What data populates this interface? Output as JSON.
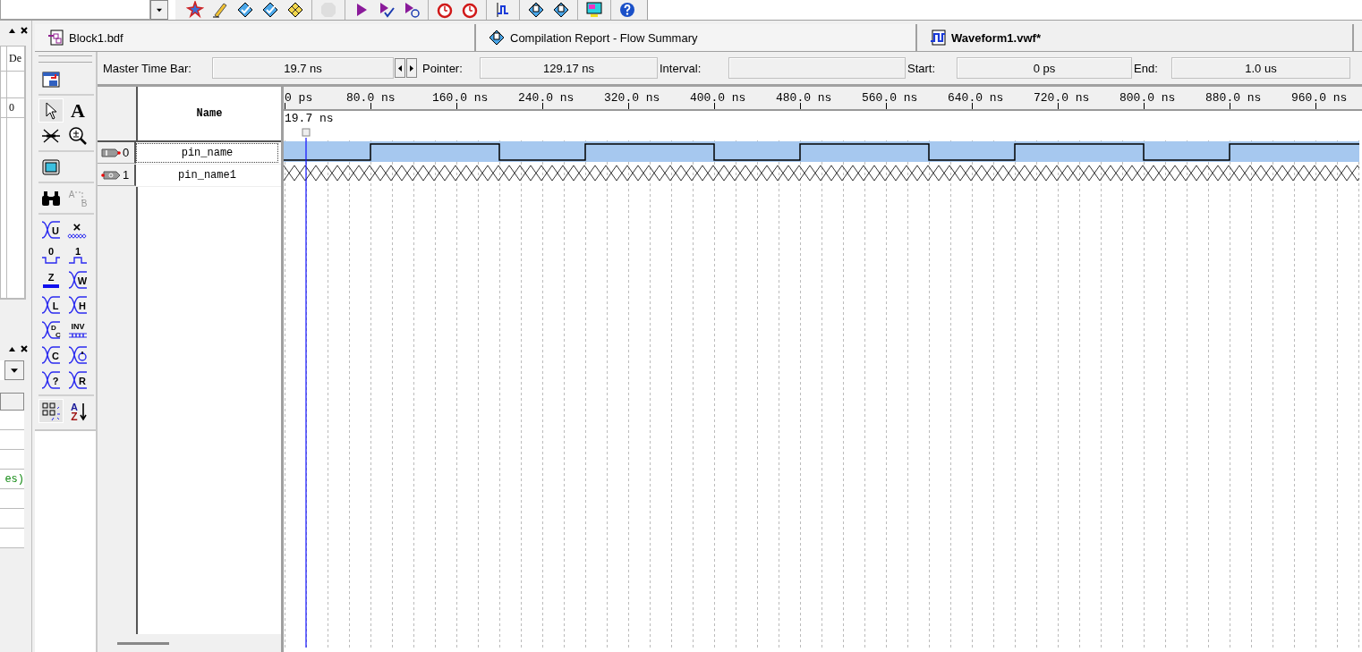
{
  "toolbar_groups": [
    [
      {
        "kind": "compile",
        "disabled": false
      },
      {
        "kind": "pencil",
        "disabled": false
      },
      {
        "kind": "check-diamond",
        "disabled": false
      },
      {
        "kind": "check-diamond",
        "disabled": false
      },
      {
        "kind": "hatch-diamond",
        "disabled": false
      }
    ],
    [
      {
        "kind": "stop",
        "disabled": true
      }
    ],
    [
      {
        "kind": "play",
        "disabled": false
      },
      {
        "kind": "play-check",
        "disabled": false
      },
      {
        "kind": "play-clock",
        "disabled": false
      }
    ],
    [
      {
        "kind": "stopwatch",
        "disabled": false
      },
      {
        "kind": "stopwatch",
        "disabled": false
      }
    ],
    [
      {
        "kind": "wave-flag",
        "disabled": false
      }
    ],
    [
      {
        "kind": "report-diamond",
        "disabled": false
      },
      {
        "kind": "report-diamond",
        "disabled": false
      }
    ],
    [
      {
        "kind": "monitor",
        "disabled": false
      }
    ],
    [
      {
        "kind": "help",
        "disabled": false
      }
    ]
  ],
  "left_panel": {
    "header": "De",
    "value": "0",
    "lower_text": "es)"
  },
  "tabs": [
    {
      "label": "Block1.bdf",
      "kind": "schematic",
      "selected": false
    },
    {
      "label": "Compilation Report - Flow Summary",
      "kind": "report",
      "selected": false
    },
    {
      "label": "Waveform1.vwf*",
      "kind": "waveform",
      "selected": true
    }
  ],
  "tool_groups": [
    [
      {
        "kind": "insert",
        "pressed": false
      }
    ],
    [
      {
        "kind": "select",
        "pressed": true
      },
      {
        "kind": "text",
        "label": "A",
        "pressed": false
      },
      {
        "kind": "fit",
        "pressed": false
      },
      {
        "kind": "zoom",
        "pressed": false
      }
    ],
    [
      {
        "kind": "full-screen",
        "pressed": false
      }
    ],
    [
      {
        "kind": "find",
        "pressed": false
      },
      {
        "kind": "replace",
        "letters": [
          "A",
          "B"
        ],
        "pressed": false
      }
    ],
    [
      {
        "kind": "value",
        "label": "U",
        "pressed": false
      },
      {
        "kind": "unknown",
        "label": "×",
        "pressed": false
      },
      {
        "kind": "low",
        "label": "0",
        "pressed": false
      },
      {
        "kind": "high",
        "label": "1",
        "pressed": false
      },
      {
        "kind": "high-z",
        "label": "Z",
        "pressed": false
      },
      {
        "kind": "value",
        "label": "W",
        "pressed": false
      },
      {
        "kind": "value",
        "label": "L",
        "pressed": false
      },
      {
        "kind": "value",
        "label": "H",
        "pressed": false
      },
      {
        "kind": "dont-care",
        "letters": [
          "D",
          "C"
        ],
        "pressed": false
      },
      {
        "kind": "invert",
        "label": "INV",
        "pressed": false
      },
      {
        "kind": "value",
        "label": "C",
        "pressed": false
      },
      {
        "kind": "clock",
        "pressed": false
      },
      {
        "kind": "value",
        "label": "?",
        "pressed": false
      },
      {
        "kind": "value",
        "label": "R",
        "pressed": false
      }
    ],
    [
      {
        "kind": "snap",
        "pressed": true
      },
      {
        "kind": "sort",
        "letters": [
          "A",
          "Z"
        ],
        "pressed": false
      }
    ]
  ],
  "time_bar": [
    {
      "kind": "master",
      "label": "Master Time Bar:",
      "value": "19.7 ns"
    },
    {
      "kind": "plain",
      "label": "Pointer:",
      "value": "129.17 ns"
    },
    {
      "kind": "plain",
      "label": "Interval:"
    },
    {
      "kind": "plain",
      "label": "Start:",
      "value": "0 ps"
    },
    {
      "kind": "plain",
      "label": "End:",
      "value": "1.0 us"
    }
  ],
  "name_header": "Name",
  "signals": [
    {
      "index": "0",
      "name": "pin_name",
      "kind": "input",
      "selected": true
    },
    {
      "index": "1",
      "name": "pin_name1",
      "kind": "output",
      "selected": false
    }
  ],
  "ruler_labels": [
    "0 ps",
    "80.0 ns",
    "160.0 ns",
    "240.0 ns",
    "320.0 ns",
    "400.0 ns",
    "480.0 ns",
    "560.0 ns",
    "640.0 ns",
    "720.0 ns",
    "800.0 ns",
    "880.0 ns",
    "960.0 ns"
  ],
  "marker_label": "19.7 ns"
}
